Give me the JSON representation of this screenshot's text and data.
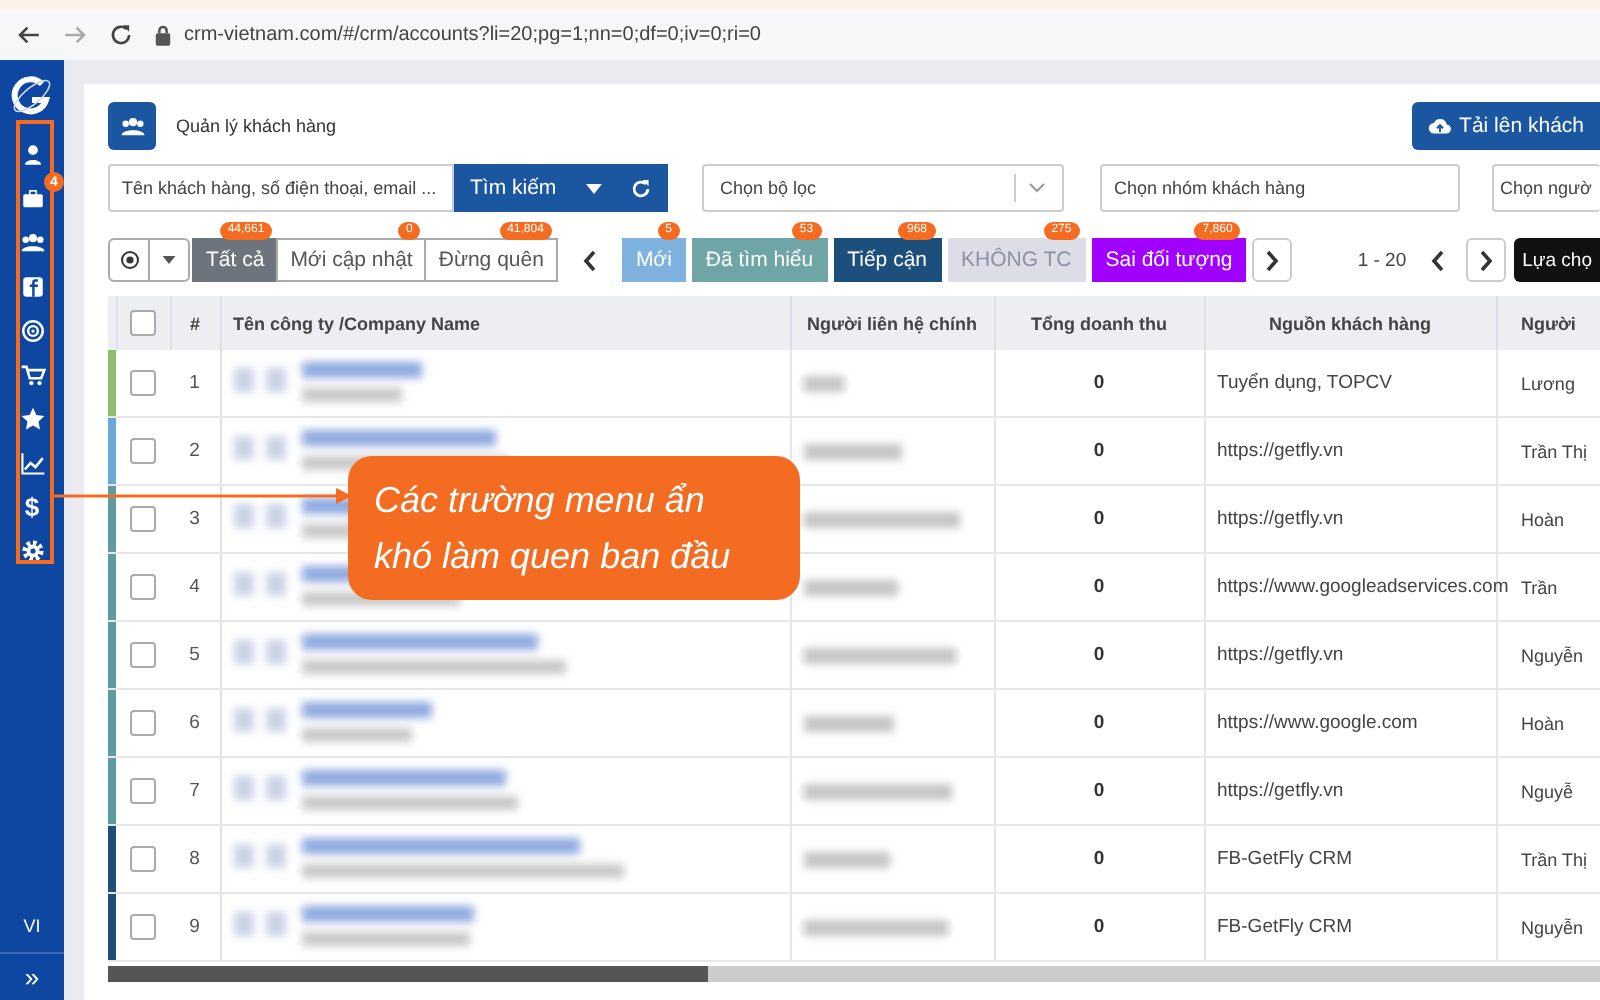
{
  "browser": {
    "url": "crm-vietnam.com/#/crm/accounts?li=20;pg=1;nn=0;df=0;iv=0;ri=0"
  },
  "sidebar": {
    "items": [
      {
        "kind": "user"
      },
      {
        "kind": "briefcase",
        "badge": "4"
      },
      {
        "kind": "group"
      },
      {
        "kind": "facebook"
      },
      {
        "kind": "target"
      },
      {
        "kind": "cart"
      },
      {
        "kind": "star"
      },
      {
        "kind": "chart"
      },
      {
        "kind": "glyph",
        "glyph": "$"
      },
      {
        "kind": "gear"
      }
    ],
    "language": "VI",
    "expand": "»"
  },
  "page": {
    "title": "Quản lý khách hàng",
    "upload_button": "Tải lên khách"
  },
  "filters": {
    "search": {
      "placeholder": "Tên khách hàng, số điện thoại, email ..."
    },
    "search_button": "Tìm kiếm",
    "filter_select": {
      "placeholder": "Chọn bộ lọc"
    },
    "group_field": {
      "placeholder": "Chọn nhóm khách hàng"
    },
    "person_field": {
      "placeholder": "Chọn ngườ"
    }
  },
  "view_tabs": [
    {
      "label": "Tất cả",
      "count": "44,661",
      "selected": true
    },
    {
      "label": "Mới cập nhật",
      "count": "0",
      "selected": false
    },
    {
      "label": "Đừng quên",
      "count": "41,804",
      "selected": false
    }
  ],
  "status_tabs": [
    {
      "label": "Mới",
      "count": "5",
      "color": "#7fb2df",
      "muted": false
    },
    {
      "label": "Đã tìm hiểu",
      "count": "53",
      "color": "#6fa5a7",
      "muted": false
    },
    {
      "label": "Tiếp cận",
      "count": "968",
      "color": "#1c4f7c",
      "muted": false
    },
    {
      "label": "KHÔNG TC",
      "count": "275",
      "color": "#dcdde6",
      "muted": true
    },
    {
      "label": "Sai đối tượng",
      "count": "7,860",
      "color": "#a000ff",
      "muted": false
    }
  ],
  "pagination": {
    "range": "1 - 20",
    "select_button": "Lựa chọ"
  },
  "table": {
    "select_all_checked": false,
    "columns": [
      "#",
      "Tên công ty /Company Name",
      "Người liên hệ chính",
      "Tổng doanh thu",
      "Nguồn khách hàng",
      "Người"
    ],
    "rows": [
      {
        "number": "1",
        "color": "#8cbf6b",
        "checked": false,
        "revenue": "0",
        "source": "Tuyển dụng, TOPCV",
        "owner": "Lương"
      },
      {
        "number": "2",
        "color": "#6aa8d8",
        "checked": false,
        "revenue": "0",
        "source": "https://getfly.vn",
        "owner": "Trần Thị"
      },
      {
        "number": "3",
        "color": "#5f9c9f",
        "checked": false,
        "revenue": "0",
        "source": "https://getfly.vn",
        "owner": "Hoàn"
      },
      {
        "number": "4",
        "color": "#5f9c9f",
        "checked": false,
        "revenue": "0",
        "source": "https://www.googleadservices.com",
        "owner": "Trần"
      },
      {
        "number": "5",
        "color": "#5f9c9f",
        "checked": false,
        "revenue": "0",
        "source": "https://getfly.vn",
        "owner": "Nguyễn"
      },
      {
        "number": "6",
        "color": "#5f9c9f",
        "checked": false,
        "revenue": "0",
        "source": "https://www.google.com",
        "owner": "Hoàn"
      },
      {
        "number": "7",
        "color": "#5f9c9f",
        "checked": false,
        "revenue": "0",
        "source": "https://getfly.vn",
        "owner": "Nguyễ"
      },
      {
        "number": "8",
        "color": "#1c4f7c",
        "checked": false,
        "revenue": "0",
        "source": "FB-GetFly CRM",
        "owner": "Trần Thị"
      },
      {
        "number": "9",
        "color": "#1c4f7c",
        "checked": false,
        "revenue": "0",
        "source": "FB-GetFly CRM",
        "owner": "Nguyễn"
      }
    ]
  },
  "callout": {
    "lines": [
      "Các trường menu ẩn",
      "khó làm quen ban đầu"
    ]
  }
}
